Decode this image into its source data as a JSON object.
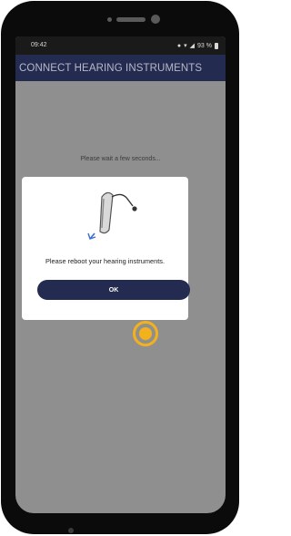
{
  "status_bar": {
    "time": "09:42",
    "battery": "93 %"
  },
  "app_bar": {
    "title": "CONNECT HEARING INSTRUMENTS"
  },
  "main": {
    "wait_text": "Please wait a few seconds..."
  },
  "dialog": {
    "message": "Please reboot your hearing instruments.",
    "ok_label": "OK"
  },
  "colors": {
    "app_bar": "#232b51",
    "ok_button": "#232b51",
    "tap_indicator": "#f3b21c",
    "overlay": "#8f8f8f"
  }
}
